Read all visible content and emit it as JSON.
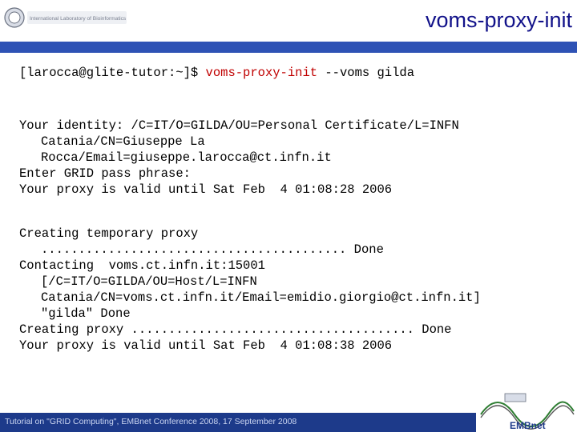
{
  "slide": {
    "title": "voms-proxy-init",
    "logo_text": "International Laboratory of Bioinformatics",
    "command": {
      "prompt": "[larocca@glite-tutor:~]$ ",
      "command": "voms-proxy-init",
      "args": " --voms gilda"
    },
    "block1": [
      "Your identity: /C=IT/O=GILDA/OU=Personal Certificate/L=INFN",
      "Catania/CN=Giuseppe La",
      "Rocca/Email=giuseppe.larocca@ct.infn.it",
      "Enter GRID pass phrase:",
      "Your proxy is valid until Sat Feb  4 01:08:28 2006"
    ],
    "block2": [
      "Creating temporary proxy",
      "......................................... Done",
      "Contacting  voms.ct.infn.it:15001",
      "[/C=IT/O=GILDA/OU=Host/L=INFN",
      "Catania/CN=voms.ct.infn.it/Email=emidio.giorgio@ct.infn.it]",
      "\"gilda\" Done",
      "Creating proxy ...................................... Done",
      "Your proxy is valid until Sat Feb  4 01:08:38 2006"
    ],
    "footer": "Tutorial on \"GRID Computing\", EMBnet Conference 2008, 17 September 2008",
    "footer_logo": "EMBnet",
    "colors": {
      "title": "#12128a",
      "rule": "#2e52b5",
      "command": "#c00000",
      "footer_bar": "#1d3a8a"
    }
  }
}
